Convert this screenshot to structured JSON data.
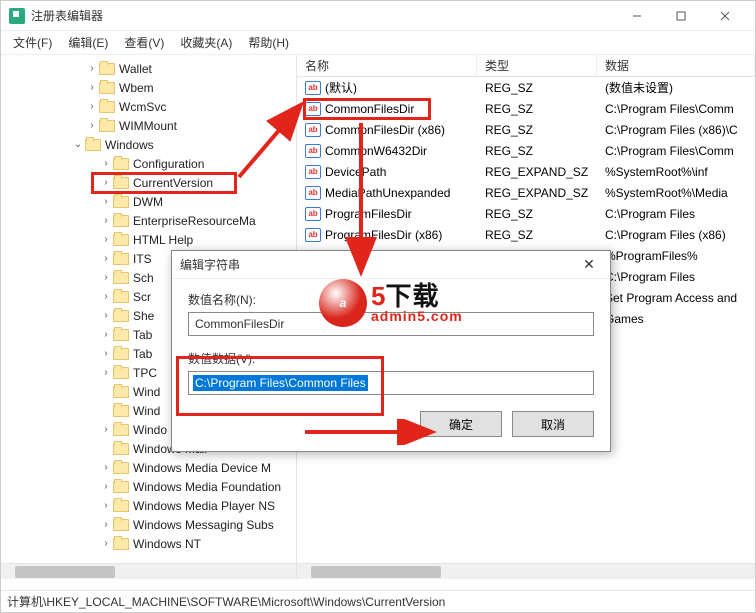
{
  "window": {
    "title": "注册表编辑器"
  },
  "menus": [
    "文件(F)",
    "编辑(E)",
    "查看(V)",
    "收藏夹(A)",
    "帮助(H)"
  ],
  "tree": [
    {
      "pad": 84,
      "tw": "close",
      "label": "Wallet"
    },
    {
      "pad": 84,
      "tw": "close",
      "label": "Wbem"
    },
    {
      "pad": 84,
      "tw": "close",
      "label": "WcmSvc"
    },
    {
      "pad": 84,
      "tw": "close",
      "label": "WIMMount"
    },
    {
      "pad": 70,
      "tw": "open",
      "label": "Windows"
    },
    {
      "pad": 98,
      "tw": "close",
      "label": "Configuration"
    },
    {
      "pad": 98,
      "tw": "close",
      "label": "CurrentVersion",
      "hl": true
    },
    {
      "pad": 98,
      "tw": "close",
      "label": "DWM"
    },
    {
      "pad": 98,
      "tw": "close",
      "label": "EnterpriseResourceMa"
    },
    {
      "pad": 98,
      "tw": "close",
      "label": "HTML Help"
    },
    {
      "pad": 98,
      "tw": "close",
      "label": "ITS"
    },
    {
      "pad": 98,
      "tw": "close",
      "label": "Sch"
    },
    {
      "pad": 98,
      "tw": "close",
      "label": "Scr"
    },
    {
      "pad": 98,
      "tw": "close",
      "label": "She"
    },
    {
      "pad": 98,
      "tw": "close",
      "label": "Tab"
    },
    {
      "pad": 98,
      "tw": "close",
      "label": "Tab"
    },
    {
      "pad": 98,
      "tw": "close",
      "label": "TPC"
    },
    {
      "pad": 98,
      "tw": "none",
      "label": "Wind"
    },
    {
      "pad": 98,
      "tw": "none",
      "label": "Wind"
    },
    {
      "pad": 98,
      "tw": "close",
      "label": "Windo"
    },
    {
      "pad": 98,
      "tw": "none",
      "label": "Windows Mail"
    },
    {
      "pad": 98,
      "tw": "close",
      "label": "Windows Media Device M"
    },
    {
      "pad": 98,
      "tw": "close",
      "label": "Windows Media Foundation"
    },
    {
      "pad": 98,
      "tw": "close",
      "label": "Windows Media Player NS"
    },
    {
      "pad": 98,
      "tw": "close",
      "label": "Windows Messaging Subs"
    },
    {
      "pad": 98,
      "tw": "close",
      "label": "Windows NT"
    }
  ],
  "list": {
    "columns": {
      "name": "名称",
      "type": "类型",
      "data": "数据"
    },
    "rows": [
      {
        "name": "(默认)",
        "type": "REG_SZ",
        "data": "(数值未设置)"
      },
      {
        "name": "CommonFilesDir",
        "type": "REG_SZ",
        "data": "C:\\Program Files\\Comm",
        "hl": true
      },
      {
        "name": "CommonFilesDir (x86)",
        "type": "REG_SZ",
        "data": "C:\\Program Files (x86)\\C"
      },
      {
        "name": "CommonW6432Dir",
        "type": "REG_SZ",
        "data": "C:\\Program Files\\Comm"
      },
      {
        "name": "DevicePath",
        "type": "REG_EXPAND_SZ",
        "data": "%SystemRoot%\\inf"
      },
      {
        "name": "MediaPathUnexpanded",
        "type": "REG_EXPAND_SZ",
        "data": "%SystemRoot%\\Media"
      },
      {
        "name": "ProgramFilesDir",
        "type": "REG_SZ",
        "data": "C:\\Program Files"
      },
      {
        "name": "ProgramFilesDir (x86)",
        "type": "REG_SZ",
        "data": "C:\\Program Files (x86)"
      },
      {
        "name": "",
        "type": "",
        "data": "%ProgramFiles%"
      },
      {
        "name": "",
        "type": "",
        "data": "C:\\Program Files"
      },
      {
        "name": "",
        "type": "",
        "data": "Set Program Access and"
      },
      {
        "name": "",
        "type": "",
        "data": "Games"
      }
    ]
  },
  "dialog": {
    "title": "编辑字符串",
    "label_name": "数值名称(N):",
    "value_name": "CommonFilesDir",
    "label_data": "数值数据(V):",
    "value_data": "C:\\Program Files\\Common Files",
    "ok": "确定",
    "cancel": "取消"
  },
  "statusbar": "计算机\\HKEY_LOCAL_MACHINE\\SOFTWARE\\Microsoft\\Windows\\CurrentVersion",
  "watermark": {
    "logo_letter": "a",
    "logo_num": "5",
    "text": "下载",
    "sub": "admin5.com"
  }
}
